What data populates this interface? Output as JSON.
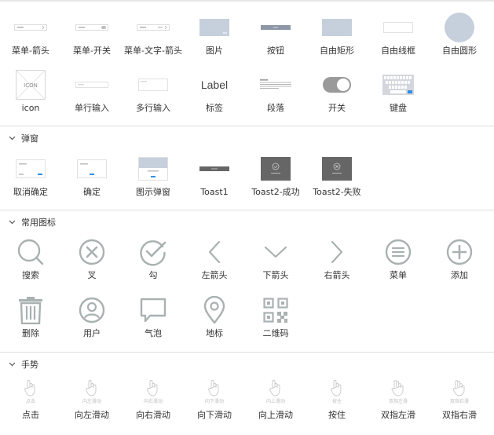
{
  "components": {
    "row1": [
      "菜单-箭头",
      "菜单-开关",
      "菜单-文字-箭头",
      "图片",
      "按钮",
      "自由矩形",
      "自由线框",
      "自由圆形"
    ],
    "row2": [
      "icon",
      "单行输入",
      "多行输入",
      "标签",
      "段落",
      "开关",
      "键盘"
    ],
    "icon_text": "ICON",
    "label_sample": "Label"
  },
  "sections": {
    "dialogs": {
      "title": "弹窗",
      "items": [
        "取消确定",
        "确定",
        "图示弹窗",
        "Toast1",
        "Toast2-成功",
        "Toast2-失败"
      ]
    },
    "icons": {
      "title": "常用图标",
      "row1": [
        "搜索",
        "叉",
        "勾",
        "左箭头",
        "下箭头",
        "右箭头",
        "菜单",
        "添加"
      ],
      "row2": [
        "删除",
        "用户",
        "气泡",
        "地标",
        "二维码"
      ]
    },
    "gestures": {
      "title": "手势",
      "items": [
        "点击",
        "向左滑动",
        "向右滑动",
        "向下滑动",
        "向上滑动",
        "按住",
        "双指左滑",
        "双指右滑"
      ],
      "captions": [
        "点击",
        "向左滑动",
        "向右滑动",
        "向下滑动",
        "向上滑动",
        "按住",
        "双指左滑",
        "双指右滑"
      ]
    }
  },
  "colors": {
    "icon_gray": "#a9b1b1",
    "placeholder_blue": "#c5d0dc",
    "button_bar": "#8d97a6",
    "toggle_gray": "#9a9a9a",
    "toast_dark": "#666666",
    "accent_blue": "#2f8ee0",
    "gesture_gray": "#c8c8c8"
  },
  "icon_names": {
    "search": "search-icon",
    "close": "close-circle-icon",
    "check": "check-circle-icon",
    "left": "chevron-left-icon",
    "down": "chevron-down-icon",
    "right": "chevron-right-icon",
    "menu": "menu-circle-icon",
    "add": "plus-circle-icon",
    "trash": "trash-icon",
    "user": "user-icon",
    "bubble": "speech-bubble-icon",
    "location": "location-pin-icon",
    "qrcode": "qr-code-icon",
    "hand": "hand-gesture-icon"
  }
}
